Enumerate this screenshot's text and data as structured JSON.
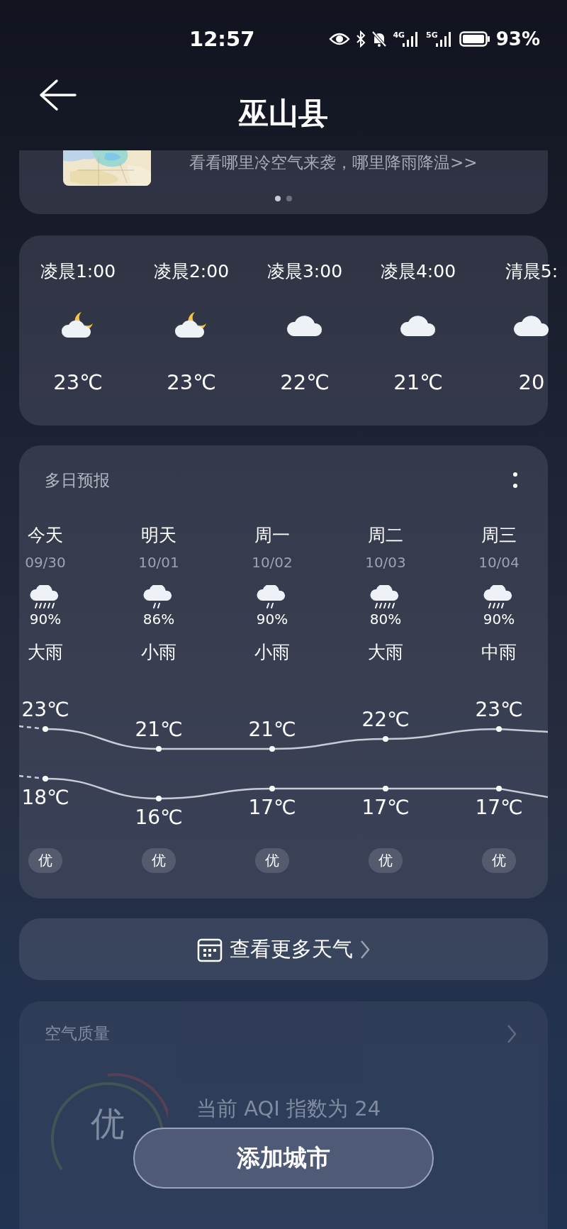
{
  "status_bar": {
    "time": "12:57",
    "network": [
      "4G",
      "5G"
    ],
    "battery": "93%"
  },
  "header": {
    "title": "巫山县"
  },
  "map_card": {
    "text": "看看哪里冷空气来袭，哪里降雨降温>>",
    "pages": [
      {
        "selected": true
      },
      {
        "selected": false
      }
    ]
  },
  "hourly": [
    {
      "time": "凌晨1:00",
      "kind": "moon_cloud",
      "temp": "23℃"
    },
    {
      "time": "凌晨2:00",
      "kind": "moon_cloud",
      "temp": "23℃"
    },
    {
      "time": "凌晨3:00",
      "kind": "cloud",
      "temp": "22℃"
    },
    {
      "time": "凌晨4:00",
      "kind": "cloud",
      "temp": "21℃"
    },
    {
      "time": "清晨5:",
      "kind": "cloud",
      "temp": "20"
    }
  ],
  "daily": {
    "title": "多日预报",
    "days": [
      {
        "day": "今天",
        "date": "09/30",
        "kind": "heavy_rain",
        "precip": "90%",
        "condition": "大雨",
        "high": "23℃",
        "low": "18℃",
        "aqi": "优"
      },
      {
        "day": "明天",
        "date": "10/01",
        "kind": "light_rain",
        "precip": "86%",
        "condition": "小雨",
        "high": "21℃",
        "low": "16℃",
        "aqi": "优"
      },
      {
        "day": "周一",
        "date": "10/02",
        "kind": "light_rain",
        "precip": "90%",
        "condition": "小雨",
        "high": "21℃",
        "low": "17℃",
        "aqi": "优"
      },
      {
        "day": "周二",
        "date": "10/03",
        "kind": "heavy_rain",
        "precip": "80%",
        "condition": "大雨",
        "high": "22℃",
        "low": "17℃",
        "aqi": "优"
      },
      {
        "day": "周三",
        "date": "10/04",
        "kind": "moderate_rain",
        "precip": "90%",
        "condition": "中雨",
        "high": "23℃",
        "low": "17℃",
        "aqi": "优"
      }
    ]
  },
  "more_button": {
    "label": "查看更多天气"
  },
  "air_quality": {
    "title": "空气质量",
    "grade": "优",
    "text": "当前 AQI 指数为 24"
  },
  "add_city_button": {
    "label": "添加城市"
  }
}
